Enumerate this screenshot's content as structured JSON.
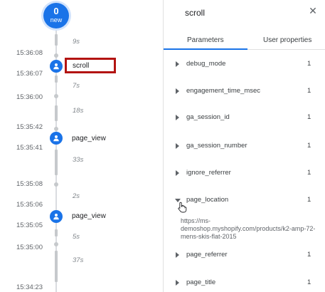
{
  "timeline": {
    "new_count": "0",
    "new_label": "new",
    "durations": [
      "9s",
      "7s",
      "18s",
      "33s",
      "2s",
      "5s",
      "37s"
    ],
    "timestamps": [
      "15:36:08",
      "15:36:07",
      "15:36:00",
      "15:35:42",
      "15:35:41",
      "15:35:08",
      "15:35:06",
      "15:35:05",
      "15:35:00",
      "15:34:23"
    ],
    "events": [
      {
        "label": "scroll",
        "selected": true
      },
      {
        "label": "page_view",
        "selected": false
      },
      {
        "label": "page_view",
        "selected": false
      }
    ]
  },
  "details": {
    "title": "scroll",
    "close_icon": "close-icon",
    "tabs": [
      {
        "label": "Parameters",
        "active": true
      },
      {
        "label": "User properties",
        "active": false
      }
    ],
    "parameters": [
      {
        "name": "debug_mode",
        "value": "1",
        "expanded": false
      },
      {
        "name": "engagement_time_msec",
        "value": "1",
        "expanded": false
      },
      {
        "name": "ga_session_id",
        "value": "1",
        "expanded": false
      },
      {
        "name": "ga_session_number",
        "value": "1",
        "expanded": false
      },
      {
        "name": "ignore_referrer",
        "value": "1",
        "expanded": false
      },
      {
        "name": "page_location",
        "value": "1",
        "expanded": true
      },
      {
        "name": "page_referrer",
        "value": "1",
        "expanded": false
      },
      {
        "name": "page_title",
        "value": "1",
        "expanded": false
      }
    ],
    "page_location_value": "https://ms-demoshop.myshopify.com/products/k2-amp-72-mens-skis-flat-2015"
  },
  "colors": {
    "accent": "#1a73e8",
    "selected_border": "#b31412"
  }
}
